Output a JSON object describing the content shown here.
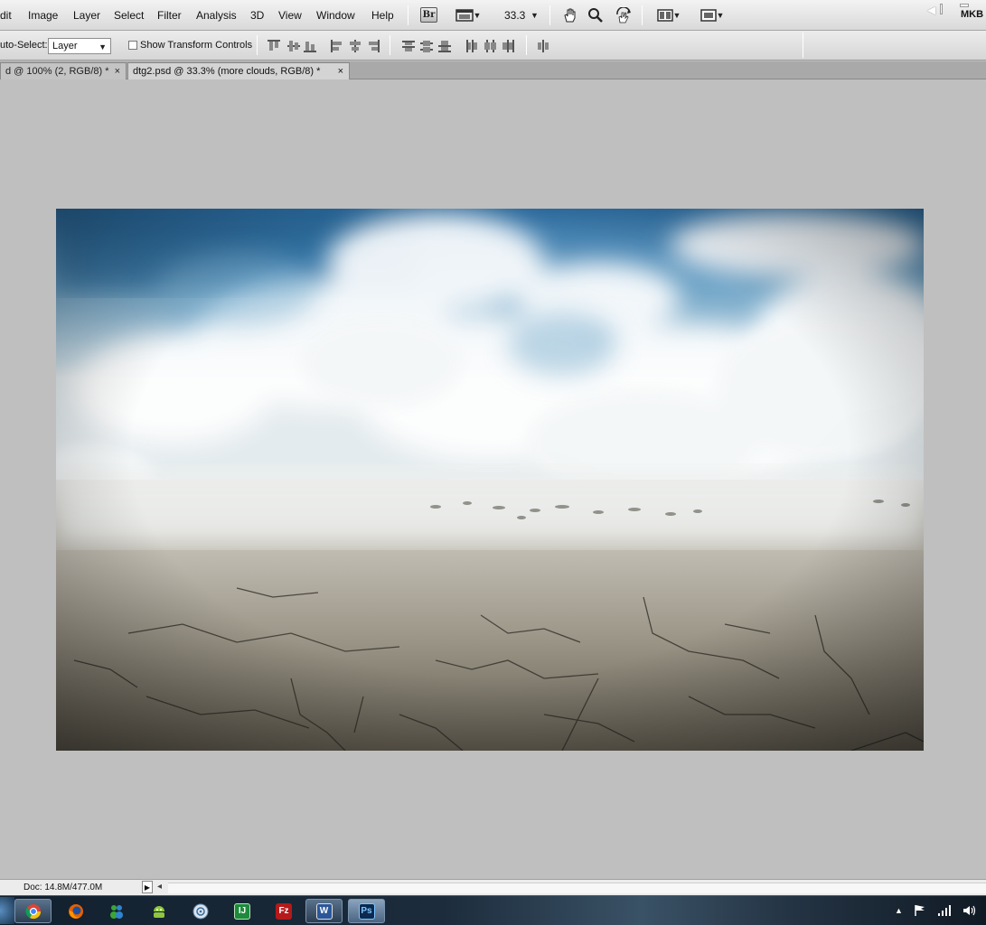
{
  "menubar": {
    "items": [
      "dit",
      "Image",
      "Layer",
      "Select",
      "Filter",
      "Analysis",
      "3D",
      "View",
      "Window",
      "Help"
    ],
    "bridge_label": "Br",
    "zoom": "33.3",
    "right_label": "MKB"
  },
  "options": {
    "auto_select_label": "uto-Select:",
    "auto_select_value": "Layer",
    "show_transform_label": "Show Transform Controls"
  },
  "tabs": [
    {
      "label": "d @ 100% (2, RGB/8) *",
      "close": "×"
    },
    {
      "label": "dtg2.psd @ 33.3% (more clouds, RGB/8) *",
      "close": "×"
    }
  ],
  "status": {
    "doc_info": "Doc: 14.8M/477.0M"
  },
  "taskbar": {
    "apps": [
      "chrome-icon",
      "firefox-icon",
      "messenger-icon",
      "android-icon",
      "itunes-icon",
      "intellij-icon",
      "filezilla-icon",
      "word-icon",
      "photoshop-icon"
    ],
    "word_label": "W",
    "photoshop_label": "Ps",
    "intellij_label": "IJ",
    "filezilla_label": "Fz"
  },
  "colors": {
    "workspace": "#bfbfbf",
    "sky_top": "#2f6fa3",
    "ground": "#8f8a7c"
  }
}
